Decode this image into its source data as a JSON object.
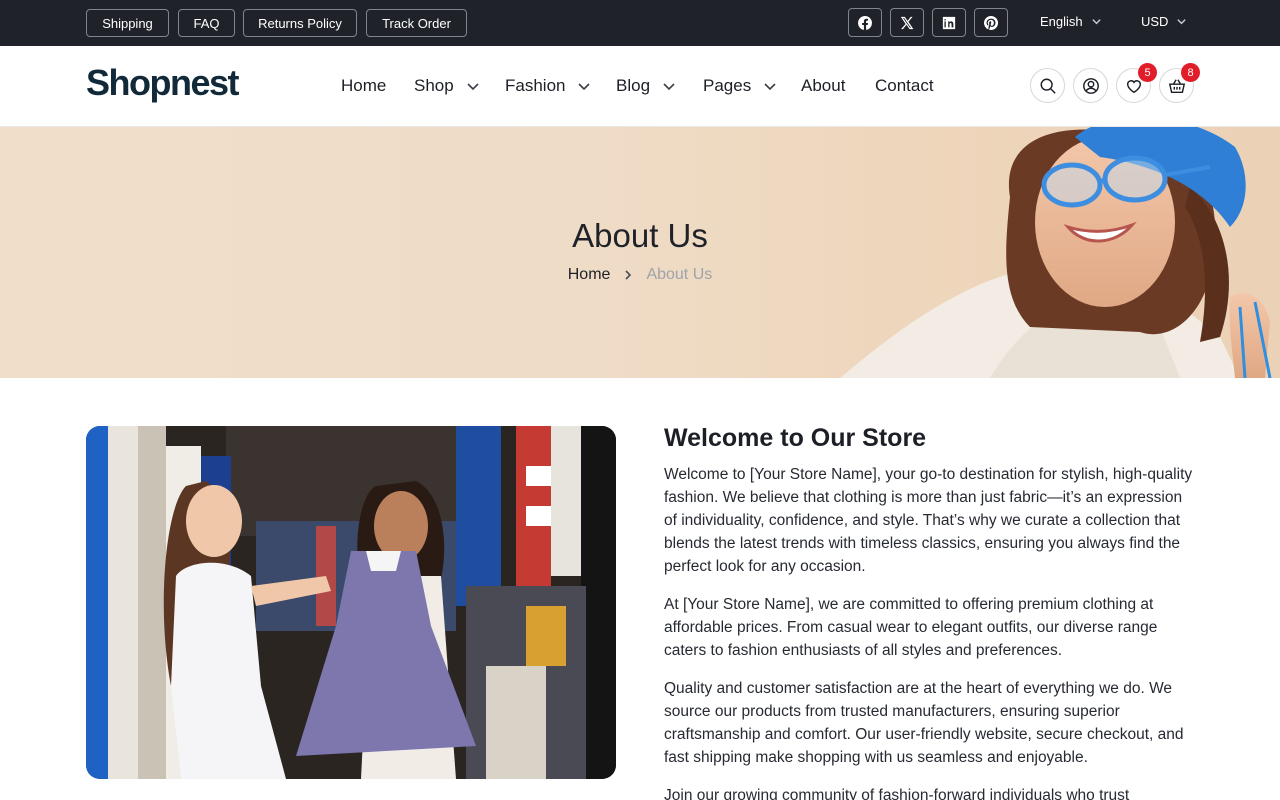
{
  "topbar": {
    "links": [
      "Shipping",
      "FAQ",
      "Returns Policy",
      "Track Order"
    ],
    "social_icons": [
      "facebook-icon",
      "x-icon",
      "linkedin-icon",
      "pinterest-icon"
    ],
    "language": "English",
    "currency": "USD"
  },
  "header": {
    "logo": "Shopnest",
    "nav": [
      {
        "label": "Home",
        "has_dropdown": false
      },
      {
        "label": "Shop",
        "has_dropdown": true
      },
      {
        "label": "Fashion",
        "has_dropdown": true
      },
      {
        "label": "Blog",
        "has_dropdown": true
      },
      {
        "label": "Pages",
        "has_dropdown": true
      },
      {
        "label": "About",
        "has_dropdown": false
      },
      {
        "label": "Contact",
        "has_dropdown": false
      }
    ],
    "icons": [
      "search-icon",
      "user-icon",
      "heart-icon",
      "cart-icon"
    ],
    "wishlist_count": "5",
    "cart_count": "8"
  },
  "hero": {
    "title": "About Us",
    "breadcrumb_home": "Home",
    "breadcrumb_current": "About Us"
  },
  "about": {
    "title": "Welcome to Our Store",
    "paragraphs": [
      "Welcome to [Your Store Name], your go-to destination for stylish, high-quality fashion. We believe that clothing is more than just fabric—it’s an expression of individuality, confidence, and style. That’s why we curate a collection that blends the latest trends with timeless classics, ensuring you always find the perfect look for any occasion.",
      "At [Your Store Name], we are committed to offering premium clothing at affordable prices. From casual wear to elegant outfits, our diverse range caters to fashion enthusiasts of all styles and preferences.",
      "Quality and customer satisfaction are at the heart of everything we do. We source our products from trusted manufacturers, ensuring superior craftsmanship and comfort. Our user-friendly website, secure checkout, and fast shipping make shopping with us seamless and enjoyable.",
      "Join our growing community of fashion-forward individuals who trust"
    ]
  },
  "colors": {
    "topbar_bg": "#1f2228",
    "badge": "#e11d2a",
    "logo": "#12293a",
    "hero_bg": "#efdcc7"
  }
}
